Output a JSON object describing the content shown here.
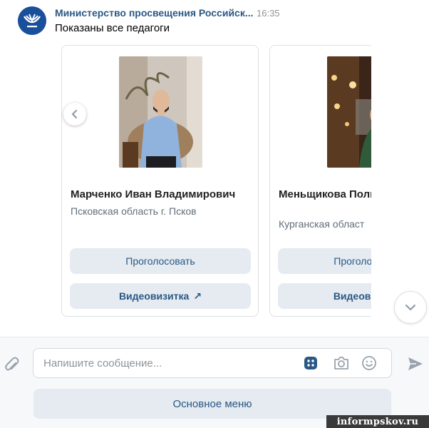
{
  "message": {
    "sender": "Министерство просвещения Российск...",
    "time": "16:35",
    "text": "Показаны все педагоги"
  },
  "cards": [
    {
      "name": "Марченко Иван Владимирович",
      "region": "Псковская область г. Псков",
      "vote_label": "Проголосовать",
      "video_label": "Видеовизитка",
      "video_arrow": "↗"
    },
    {
      "name": "Меньщикова Поли Владимировна",
      "region": "Курганская област",
      "vote_label": "Проголосовать",
      "video_label": "Видеовизитка"
    }
  ],
  "composer": {
    "placeholder": "Напишите сообщение...",
    "menu_label": "Основное меню"
  },
  "icons": {
    "carousel_prev": "chevron-left-icon",
    "scroll_down": "chevron-down-icon",
    "attach": "paperclip-icon",
    "keyboard": "bot-keyboard-icon",
    "camera": "camera-icon",
    "emoji": "smile-icon",
    "send": "send-icon"
  },
  "colors": {
    "link": "#2a5885",
    "button_bg": "#e5ebf1",
    "avatar_bg": "#1a4f9c"
  },
  "watermark": "informpskov.ru"
}
